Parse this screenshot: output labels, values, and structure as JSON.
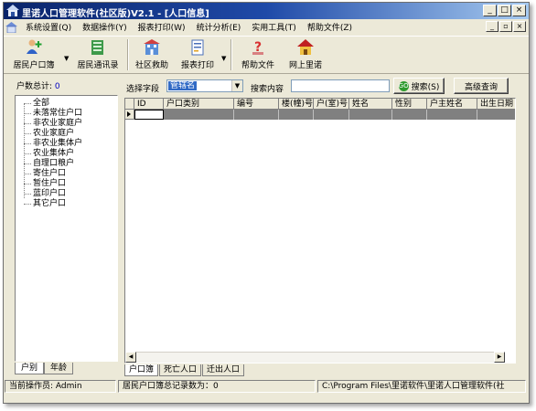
{
  "window": {
    "title": "里诺人口管理软件(社区版)V2.1 - [人口信息]",
    "caption_buttons": [
      "_",
      "□",
      "×"
    ],
    "mdi_buttons": [
      "_",
      "▫",
      "×"
    ]
  },
  "menu": {
    "items": [
      {
        "label": "系统设置(Q)"
      },
      {
        "label": "数据操作(Y)"
      },
      {
        "label": "报表打印(W)"
      },
      {
        "label": "统计分析(E)"
      },
      {
        "label": "实用工具(T)"
      },
      {
        "label": "帮助文件(Z)"
      }
    ]
  },
  "toolbar": {
    "resident_book": "居民户口簿",
    "resident_contacts": "居民通讯录",
    "community_aid": "社区救助",
    "report_print": "报表打印",
    "help_file": "帮助文件",
    "online_rino": "网上里诺"
  },
  "left_panel": {
    "count_label": "户数总计:",
    "count_value": "0",
    "tree": [
      "全部",
      "未落常住户口",
      "非农业家庭户",
      "农业家庭户",
      "非农业集体户",
      "农业集体户",
      "自理口粮户",
      "寄住户口",
      "暂住户口",
      "蓝印户口",
      "其它户口"
    ],
    "tabs": [
      "户别",
      "年龄"
    ]
  },
  "search": {
    "field_label": "选择字段",
    "field_value": "管辖名",
    "content_label": "搜索内容",
    "content_value": "",
    "search_button": "搜索(S)",
    "advanced_button": "高级查询"
  },
  "grid": {
    "columns": [
      "ID",
      "户口类别",
      "编号",
      "楼(幢)号",
      "户(室)号",
      "姓名",
      "性别",
      "户主姓名",
      "出生日期"
    ]
  },
  "grid_tabs": [
    "户口簿",
    "死亡人口",
    "迁出人口"
  ],
  "status": {
    "operator": "当前操作员: Admin",
    "record_count": "居民户口簿总记录数为：0",
    "path": "C:\\Program Files\\里诺软件\\里诺人口管理软件(社"
  },
  "colors": {
    "title_start": "#0a246a",
    "title_end": "#a6caf0",
    "selection": "#316ac5",
    "count_value": "#0000c0"
  }
}
